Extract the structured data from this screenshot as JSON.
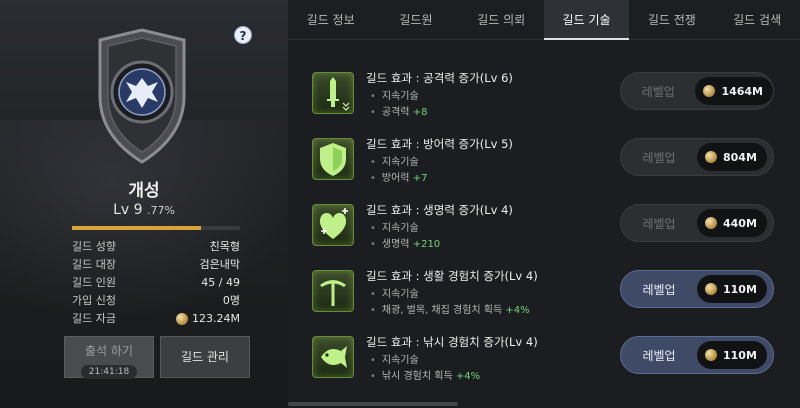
{
  "help_icon": "?",
  "guild": {
    "name": "개성",
    "level_label": "Lv 9",
    "level_pct": ".77%",
    "xp_fraction": 0.77,
    "info": [
      {
        "key": "길드 성향",
        "value": "친목형"
      },
      {
        "key": "길드 대장",
        "value": "검은내막"
      },
      {
        "key": "길드 인원",
        "value": "45 / 49"
      },
      {
        "key": "가입 신청",
        "value": "0명"
      },
      {
        "key": "길드 자금",
        "value": "123.24M",
        "icon": "coin-icon"
      }
    ],
    "attend_label": "출석 하기",
    "attend_timer": "21:41:18",
    "manage_label": "길드 관리"
  },
  "tabs": [
    {
      "label": "길드 정보",
      "active": false
    },
    {
      "label": "길드원",
      "active": false
    },
    {
      "label": "길드 의뢰",
      "active": false
    },
    {
      "label": "길드 기술",
      "active": true
    },
    {
      "label": "길드 전쟁",
      "active": false
    },
    {
      "label": "길드 검색",
      "active": false
    }
  ],
  "skills": [
    {
      "icon": "sword-icon",
      "title": "길드 효과 : 공격력 증가(Lv 6)",
      "type": "지속기술",
      "stat": "공격력",
      "bonus": "+8",
      "button": "레벨업",
      "cost": "1464M",
      "enabled": false
    },
    {
      "icon": "shield-icon",
      "title": "길드 효과 : 방어력 증가(Lv 5)",
      "type": "지속기술",
      "stat": "방어력",
      "bonus": "+7",
      "button": "레벨업",
      "cost": "804M",
      "enabled": false
    },
    {
      "icon": "heart-plus-icon",
      "title": "길드 효과 : 생명력 증가(Lv 4)",
      "type": "지속기술",
      "stat": "생명력",
      "bonus": "+210",
      "button": "레벨업",
      "cost": "440M",
      "enabled": false
    },
    {
      "icon": "pickaxe-icon",
      "title": "길드 효과 : 생활 경험치 증가(Lv 4)",
      "type": "지속기술",
      "stat": "채광, 벌목, 채집 경험치 획득",
      "bonus": "+4%",
      "button": "레벨업",
      "cost": "110M",
      "enabled": true
    },
    {
      "icon": "fish-icon",
      "title": "길드 효과 : 낚시 경험치 증가(Lv 4)",
      "type": "지속기술",
      "stat": "낚시 경험치 획득",
      "bonus": "+4%",
      "button": "레벨업",
      "cost": "110M",
      "enabled": true
    }
  ],
  "colors": {
    "accent_gold": "#d9a23b",
    "bonus_green": "#6fd67a",
    "button_enabled": "#3e4a66"
  }
}
